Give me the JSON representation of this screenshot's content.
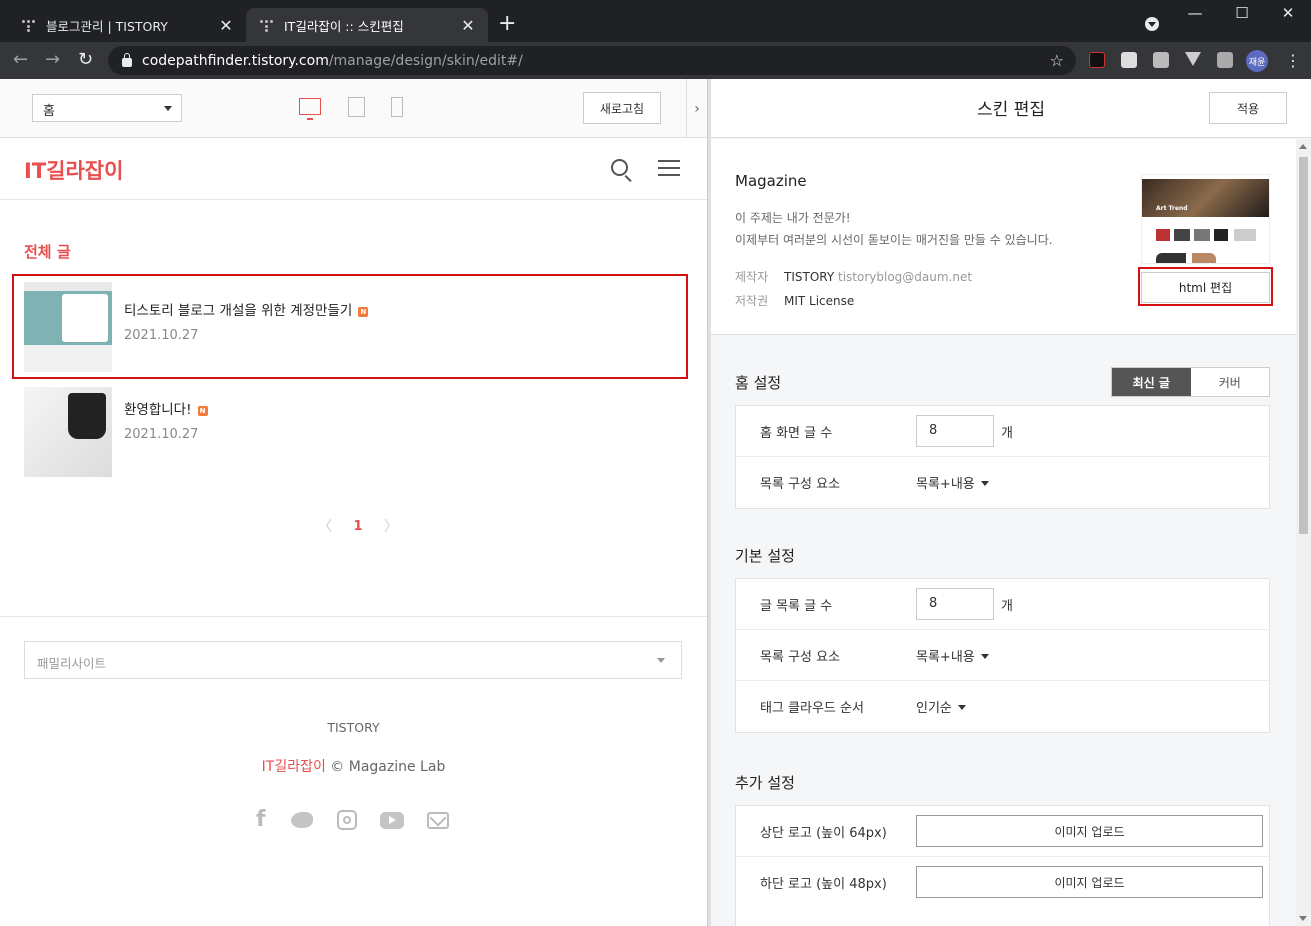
{
  "browser": {
    "tabs": [
      {
        "title": "블로그관리 | TISTORY",
        "close": "✕"
      },
      {
        "title": "IT길라잡이 :: 스킨편집",
        "close": "✕"
      }
    ],
    "new_tab": "+",
    "window_controls": {
      "minimize": "—",
      "maximize": "☐",
      "close": "✕"
    },
    "url_host": "codepathfinder.tistory.com",
    "url_path": "/manage/design/skin/edit#/",
    "profile_initials": "재윤",
    "nav": {
      "back": "←",
      "forward": "→",
      "reload": "↻"
    },
    "star": "☆",
    "menu": "⋮"
  },
  "preview": {
    "page_select": "홈",
    "refresh_label": "새로고침",
    "collapse": "›",
    "blog_title": "IT길라잡이",
    "section_title": "전체 글",
    "posts": [
      {
        "title": "티스토리 블로그 개설을 위한 계정만들기",
        "badge": "N",
        "date": "2021.10.27"
      },
      {
        "title": "환영합니다!",
        "badge": "N",
        "date": "2021.10.27"
      }
    ],
    "pager": {
      "prev": "〈",
      "current": "1",
      "next": "〉"
    },
    "family_site_placeholder": "패밀리사이트",
    "footer_brand": "TISTORY",
    "footer_blog": "IT길라잡이",
    "footer_copy": " © Magazine Lab",
    "social_fb": "f"
  },
  "editor": {
    "title": "스킨 편집",
    "apply_label": "적용",
    "skin": {
      "name": "Magazine",
      "desc_line1": "이 주제는 내가 전문가!",
      "desc_line2": "이제부터 여러분의 시선이 돋보이는 매거진을 만들 수 있습니다.",
      "author_key": "제작자",
      "author_name": "TISTORY",
      "author_email": "tistoryblog@daum.net",
      "license_key": "저작권",
      "license": "MIT License",
      "thumb_caption": "Art Trend",
      "html_edit_label": "html 편집"
    },
    "home_settings": {
      "title": "홈 설정",
      "tabs": [
        "최신 글",
        "커버"
      ],
      "rows": [
        {
          "label": "홈 화면 글 수",
          "value": "8",
          "unit": "개"
        },
        {
          "label": "목록 구성 요소",
          "value": "목록+내용"
        }
      ]
    },
    "basic_settings": {
      "title": "기본 설정",
      "rows": [
        {
          "label": "글 목록 글 수",
          "value": "8",
          "unit": "개"
        },
        {
          "label": "목록 구성 요소",
          "value": "목록+내용"
        },
        {
          "label": "태그 클라우드 순서",
          "value": "인기순"
        }
      ]
    },
    "extra_settings": {
      "title": "추가 설정",
      "rows": [
        {
          "label": "상단 로고 (높이 64px)",
          "button": "이미지 업로드"
        },
        {
          "label": "하단 로고 (높이 48px)",
          "button": "이미지 업로드"
        }
      ]
    }
  },
  "colors": {
    "accent_red": "#e84f4f",
    "highlight": "#d31010",
    "badge": "#f27a3a"
  }
}
